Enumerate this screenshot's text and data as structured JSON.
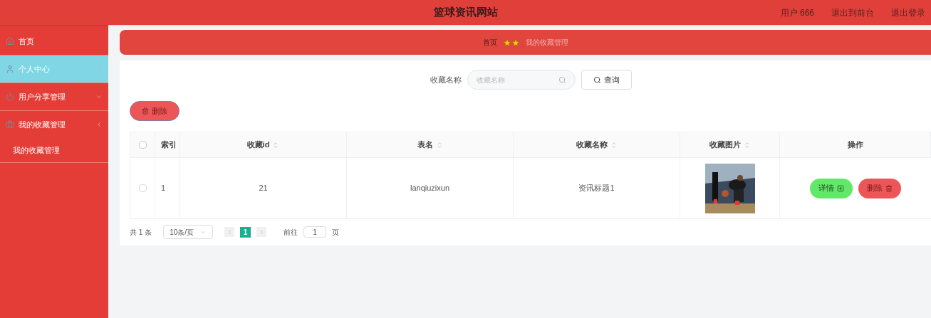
{
  "header": {
    "title": "篮球资讯网站",
    "links": [
      "用户 666",
      "退出到前台",
      "退出登录"
    ]
  },
  "sidebar": {
    "items": [
      {
        "label": "首页",
        "selected": false,
        "has_caret": false
      },
      {
        "label": "个人中心",
        "selected": true,
        "has_caret": true
      },
      {
        "label": "用户分享管理",
        "selected": false,
        "has_caret": true
      },
      {
        "label": "我的收藏管理",
        "selected": false,
        "has_caret": true,
        "children": [
          {
            "label": "我的收藏管理",
            "selected": false
          }
        ]
      }
    ]
  },
  "breadcrumb": {
    "home": "首页",
    "current": "我的收藏管理"
  },
  "search": {
    "label": "收藏名称",
    "placeholder": "收藏名称",
    "button": "查询"
  },
  "delete_button": "删除",
  "table": {
    "columns": [
      {
        "label": "索引",
        "sortable": false
      },
      {
        "label": "收藏id",
        "sortable": true
      },
      {
        "label": "表名",
        "sortable": true
      },
      {
        "label": "收藏名称",
        "sortable": true
      },
      {
        "label": "收藏图片",
        "sortable": true
      },
      {
        "label": "操作",
        "sortable": false
      }
    ],
    "header_checked": false,
    "rows": [
      {
        "checked": false,
        "index": "1",
        "id": "21",
        "table": "lanqiuzixun",
        "name": "资讯标题1",
        "image": {
          "kind": "picture"
        },
        "actions": [
          "详情",
          "删除"
        ]
      }
    ]
  },
  "pagination": {
    "total": "共 1 条",
    "page_size": "10条/页",
    "pages": [
      {
        "label": "1",
        "selected": true
      }
    ],
    "goto_label": "前往",
    "goto_value": "1",
    "page_suffix": "页"
  }
}
